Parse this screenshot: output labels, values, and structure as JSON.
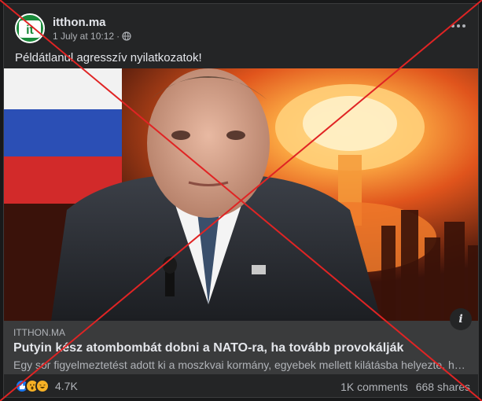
{
  "post": {
    "page_name": "itthon.ma",
    "date": "1 July at 10:12",
    "date_separator": "·",
    "caption": "Példátlanul agresszív nyilatkozatok!",
    "link": {
      "domain": "ITTHON.MA",
      "title": "Putyin kész atombombát dobni a NATO-ra, ha tovább provokálják",
      "description": "Egy sor figyelmeztetést adott ki a moszkvai kormány, egyebek mellett kilátásba helyezte, hogy..."
    },
    "info_label": "i",
    "reactions": {
      "count": "4.7K",
      "icons": [
        "like-icon",
        "wow-icon",
        "haha-icon"
      ]
    },
    "comments": "1K comments",
    "shares": "668 shares"
  },
  "logo_text": "it",
  "colors": {
    "background": "#242526",
    "cross": "#e02424",
    "brand": "#1a8a3b",
    "link_bg": "#3a3b3c"
  }
}
